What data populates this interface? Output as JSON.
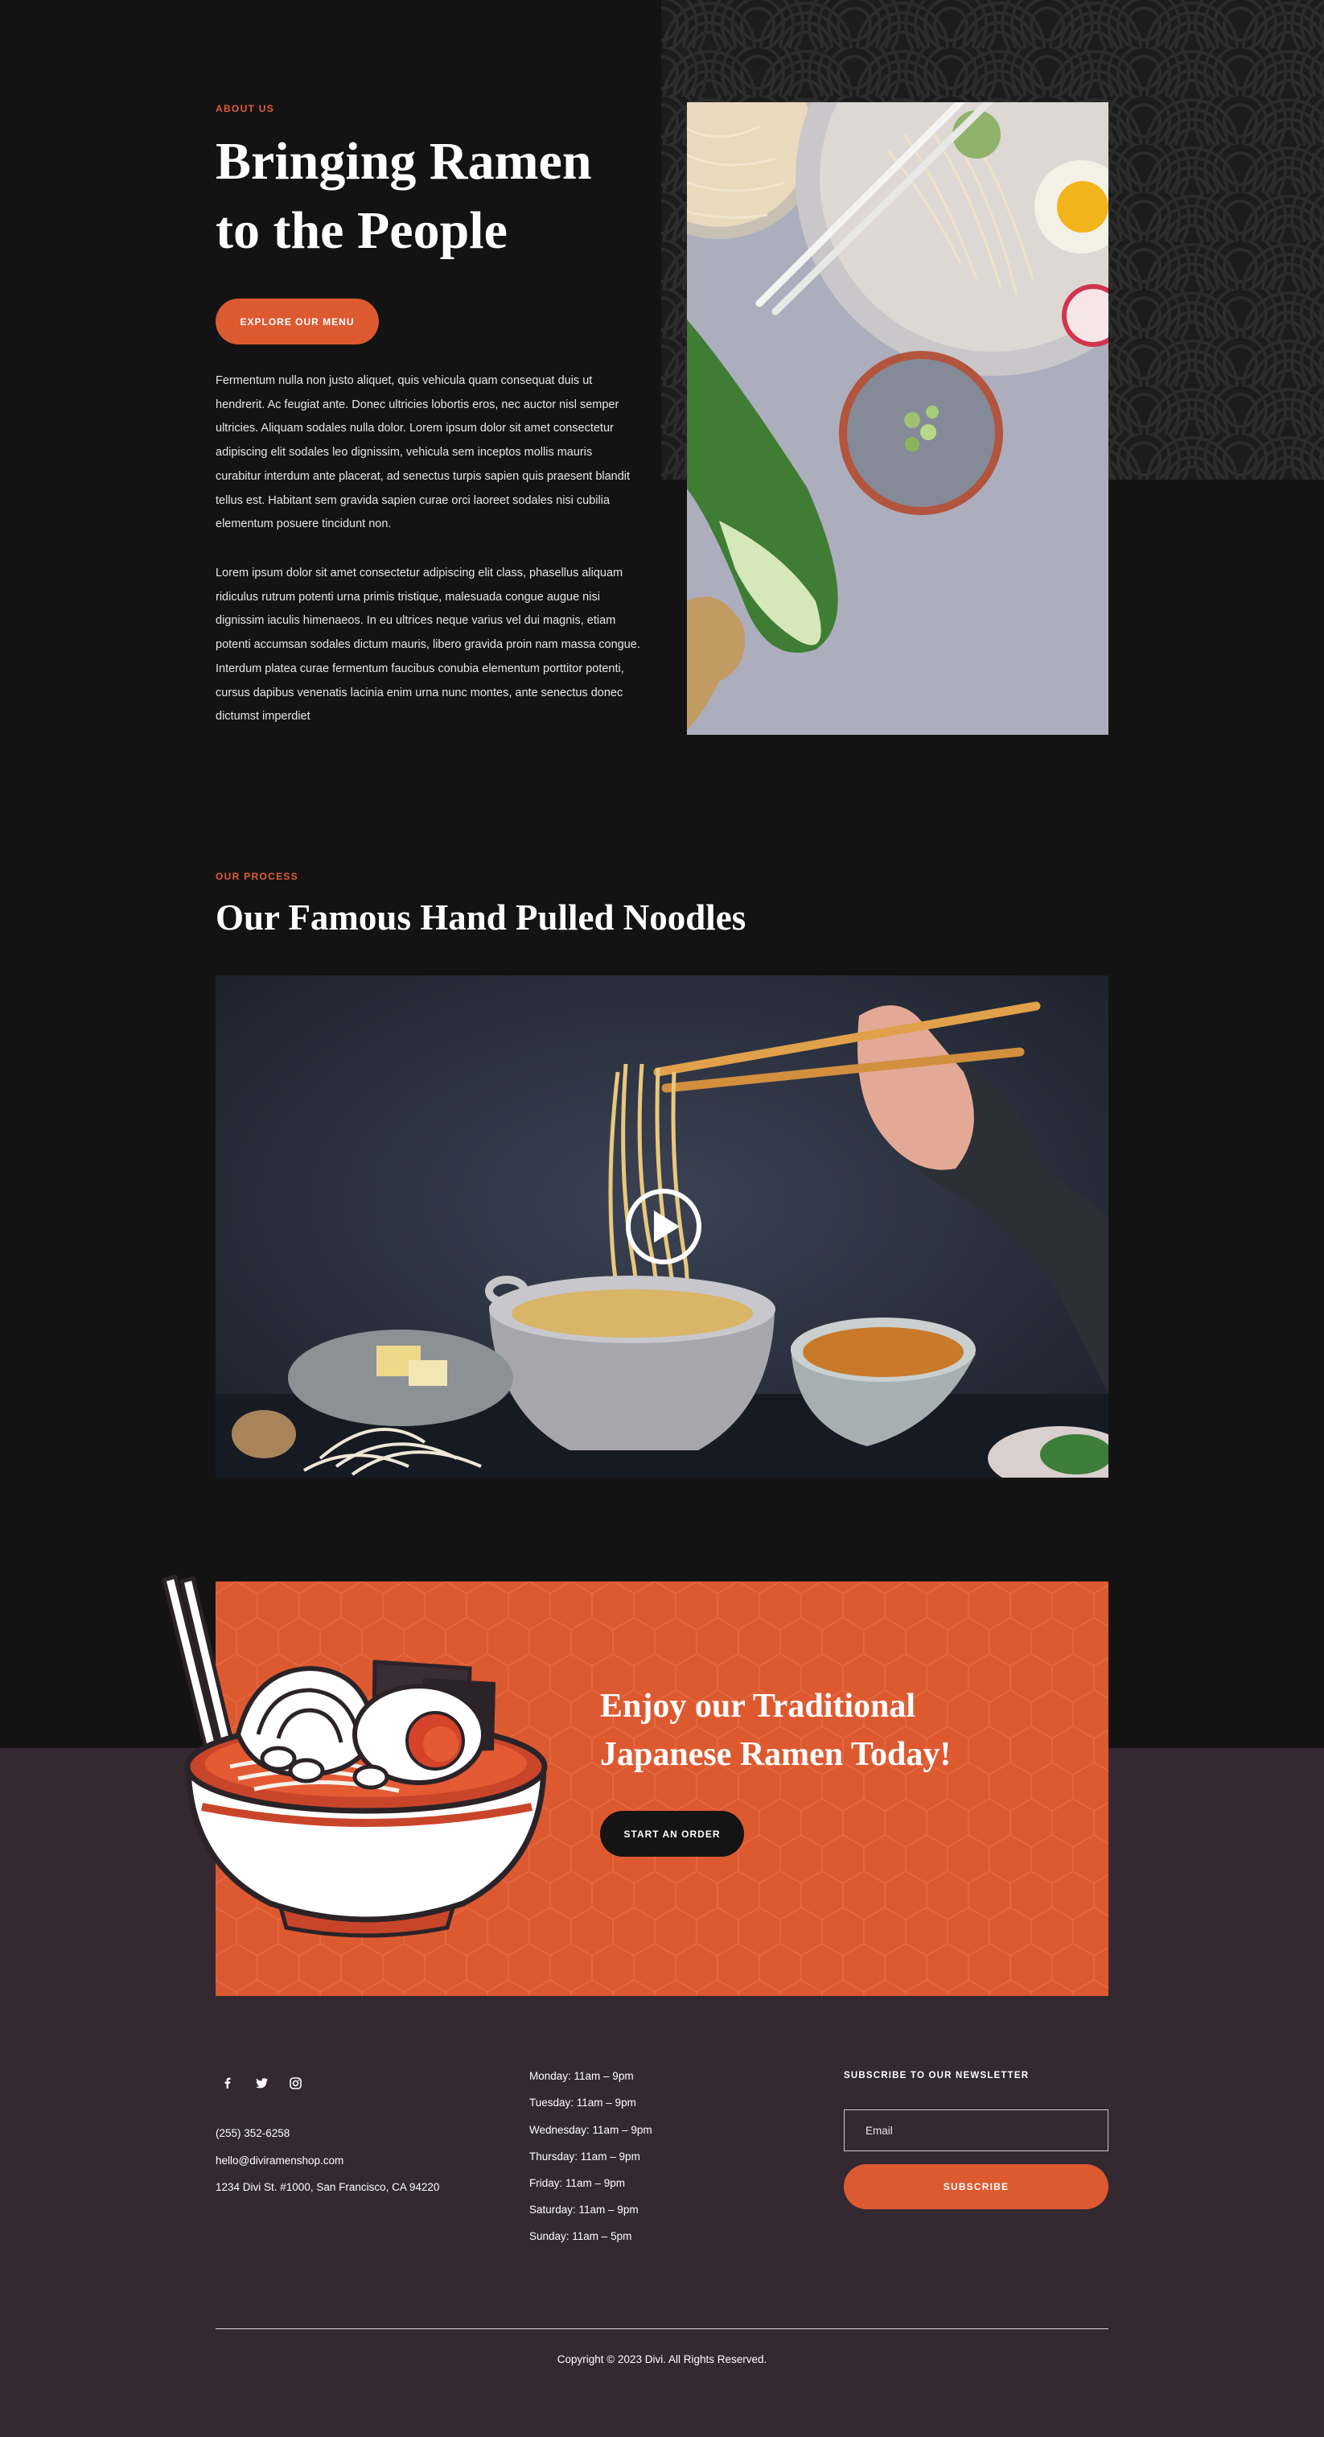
{
  "about": {
    "eyebrow": "ABOUT US",
    "title_line1": "Bringing Ramen",
    "title_line2": "to the People",
    "button": "EXPLORE OUR MENU",
    "paragraph1": "Fermentum nulla non justo aliquet, quis vehicula quam consequat duis ut hendrerit. Ac feugiat ante. Donec ultricies lobortis eros, nec auctor nisl semper ultricies. Aliquam sodales nulla dolor. Lorem ipsum dolor sit amet consectetur adipiscing elit sodales leo dignissim, vehicula sem inceptos mollis mauris curabitur interdum ante placerat, ad senectus turpis sapien quis praesent blandit tellus est. Habitant sem gravida sapien curae orci laoreet sodales nisi cubilia elementum posuere tincidunt non.",
    "paragraph2": "Lorem ipsum dolor sit amet consectetur adipiscing elit class, phasellus aliquam ridiculus rutrum potenti urna primis tristique, malesuada congue augue nisi dignissim iaculis himenaeos. In eu ultrices neque varius vel dui magnis, etiam potenti accumsan sodales dictum mauris, libero gravida proin nam massa congue. Interdum platea curae fermentum faucibus conubia elementum porttitor potenti, cursus dapibus venenatis lacinia enim urna nunc montes, ante senectus donec dictumst imperdiet"
  },
  "process": {
    "eyebrow": "OUR PROCESS",
    "title": "Our Famous Hand Pulled Noodles"
  },
  "cta": {
    "title_line1": "Enjoy our Traditional",
    "title_line2": "Japanese Ramen Today!",
    "button": "START AN ORDER"
  },
  "footer": {
    "social_icons": [
      "facebook-icon",
      "twitter-icon",
      "instagram-icon"
    ],
    "phone": "(255) 352-6258",
    "email": "hello@diviramenshop.com",
    "address": "1234 Divi St. #1000, San Francisco, CA 94220",
    "hours": [
      "Monday: 11am – 9pm",
      "Tuesday: 11am – 9pm",
      "Wednesday: 11am – 9pm",
      "Thursday: 11am – 9pm",
      "Friday: 11am – 9pm",
      "Saturday: 11am – 9pm",
      "Sunday: 11am – 5pm"
    ],
    "newsletter_heading": "SUBSCRIBE TO OUR NEWSLETTER",
    "email_placeholder": "Email",
    "subscribe_button": "SUBSCRIBE",
    "copyright": "Copyright © 2023 Divi. All Rights Reserved."
  },
  "colors": {
    "background": "#131313",
    "accent": "#dd5a31",
    "footer": "#342831"
  }
}
